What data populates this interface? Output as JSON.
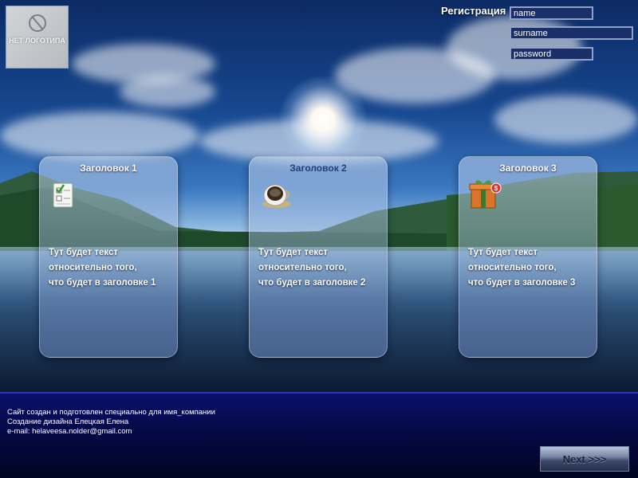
{
  "logo": {
    "text": "НЕТ ЛОГОТИПА",
    "icon": "no-logo-icon"
  },
  "registration": {
    "title": "Регистрация",
    "fields": {
      "name": "name",
      "surname": "surname",
      "password": "password"
    }
  },
  "cards": [
    {
      "title": "Заголовок 1",
      "icon": "checklist-icon",
      "lines": [
        "Тут будет текст",
        "относительно того,",
        "что будет в заголовке 1"
      ]
    },
    {
      "title": "Заголовок 2",
      "icon": "coffee-cup-icon",
      "lines": [
        "Тут будет текст",
        "относительно того,",
        "что будет в заголовке 2"
      ]
    },
    {
      "title": "Заголовок 3",
      "icon": "gift-box-icon",
      "lines": [
        "Тут будет текст",
        "относительно того,",
        "что будет в заголовке 3"
      ]
    }
  ],
  "footer": {
    "line1": "Сайт создан и подготовлен специально для имя_компании",
    "line2": "Создание дизайна Елецкая Елена",
    "line3": "e-mail: helaveesa.nolder@gmail.com",
    "next_label": "Next >>>"
  },
  "colors": {
    "footer_bg": "#050a4a",
    "field_border": "#8ea3c7",
    "card2_title": "#233f7a"
  }
}
